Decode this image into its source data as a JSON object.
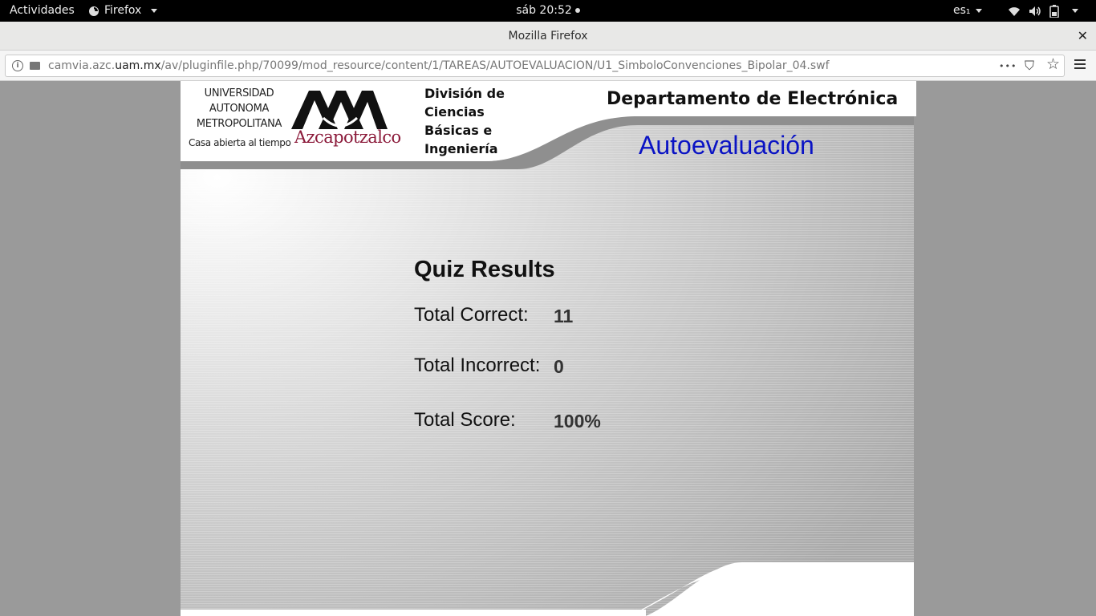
{
  "topbar": {
    "activities": "Actividades",
    "app_name": "Firefox",
    "clock": "sáb 20:52",
    "language": "es₁",
    "icons": [
      "wifi-icon",
      "volume-icon",
      "battery-icon",
      "power-menu-icon"
    ]
  },
  "window": {
    "title": "Mozilla Firefox",
    "close_glyph": "✕"
  },
  "navbar": {
    "url_prefix": "camvia.azc.",
    "url_domain": "uam.mx",
    "url_path": "/av/pluginfile.php/70099/mod_resource/content/1/TAREAS/AUTOEVALUACION/U1_SimboloConvenciones_Bipolar_04.swf",
    "more_glyph": "•••",
    "pocket_glyph": "⛉",
    "bookmark_glyph": "☆"
  },
  "header": {
    "university_lines": [
      "UNIVERSIDAD",
      "AUTONOMA",
      "METROPOLITANA"
    ],
    "tagline": "Casa abierta al tiempo",
    "campus": "Azcapotzalco",
    "division_lines": [
      "División de",
      "Ciencias",
      "Básicas e",
      "Ingeniería"
    ],
    "department": "Departamento de Electrónica",
    "section": "Autoevaluación"
  },
  "quiz": {
    "title": "Quiz Results",
    "correct_label": "Total Correct:",
    "correct_value": "11",
    "incorrect_label": "Total Incorrect:",
    "incorrect_value": "0",
    "score_label": "Total Score:",
    "score_value": "100%"
  },
  "colors": {
    "section_blue": "#0a13c4",
    "campus_red": "#8b1a3a",
    "background_gray": "#9a9a9a"
  }
}
